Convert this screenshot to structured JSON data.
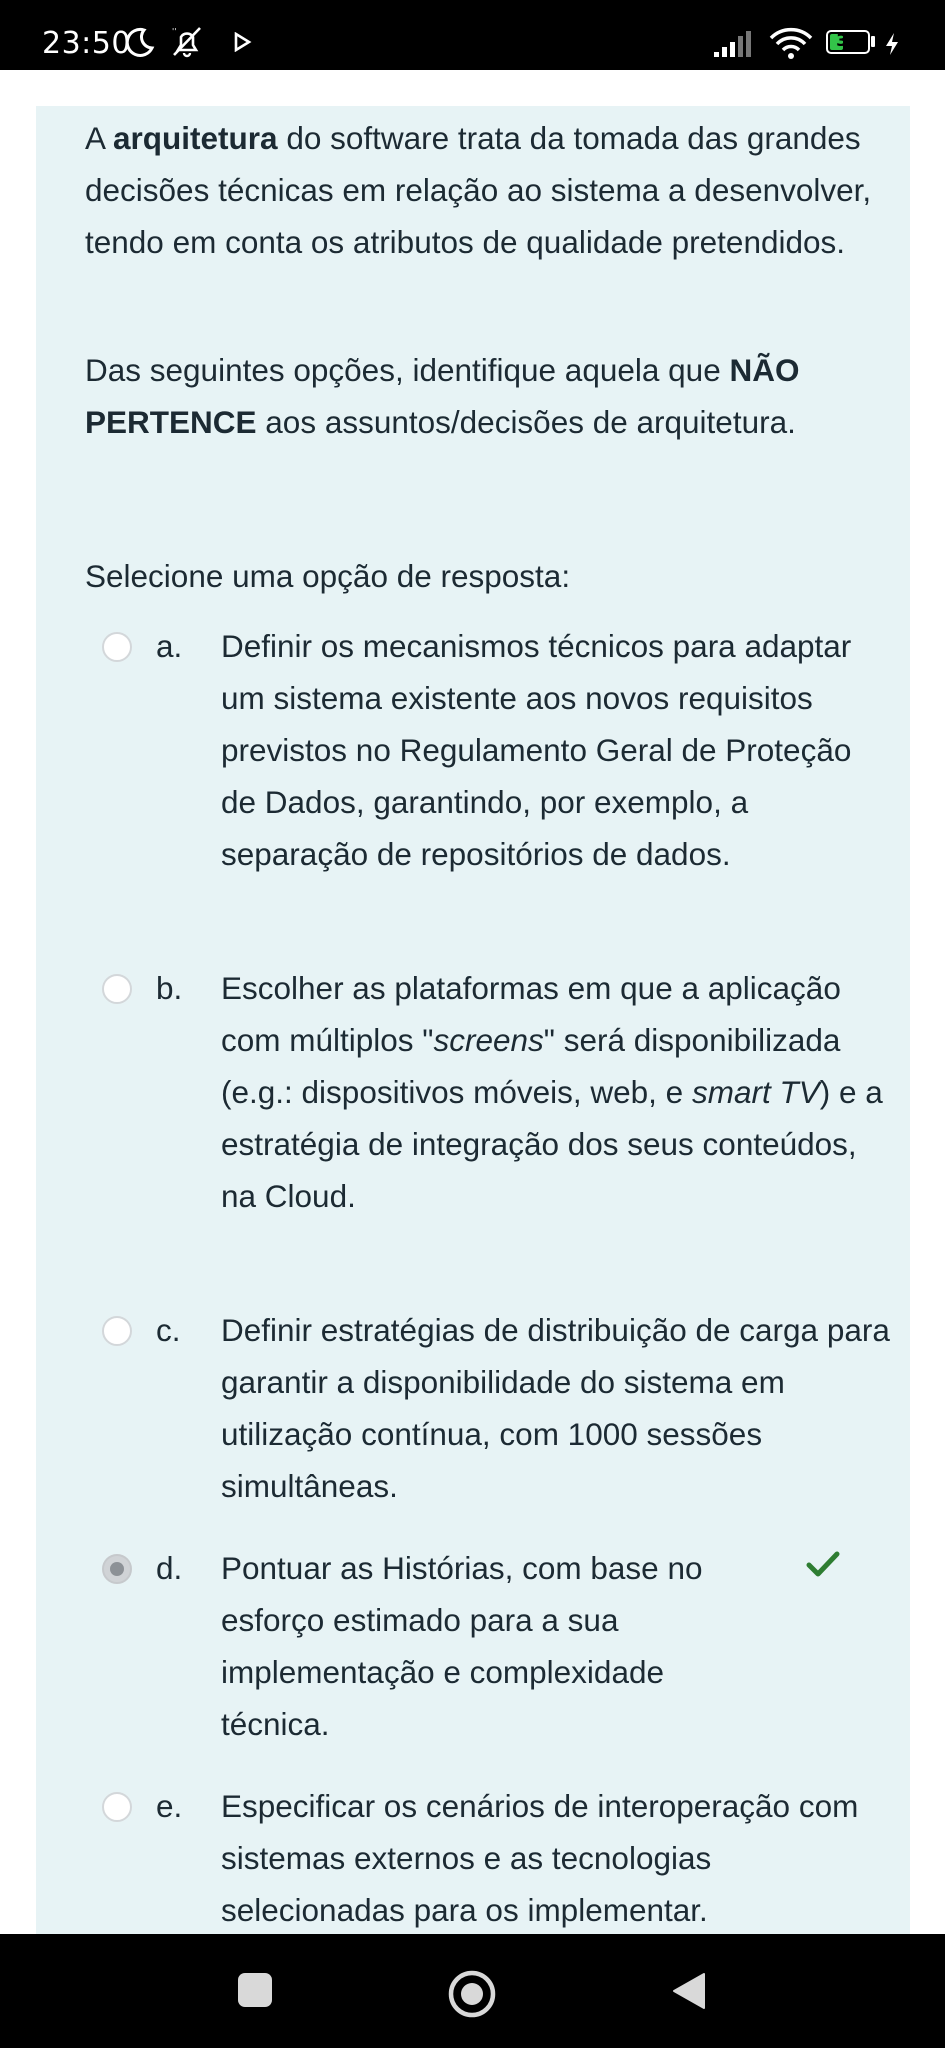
{
  "status_bar": {
    "time": "23:50",
    "battery": "35",
    "battery_level_percent": 35,
    "icons": [
      "moon-icon",
      "notifications-off-icon",
      "play-icon",
      "signal-icon",
      "wifi-icon",
      "battery-icon",
      "charging-icon"
    ]
  },
  "question": {
    "intro_pre": "A ",
    "intro_bold": "arquitetura",
    "intro_post": " do software trata da tomada das grandes decisões técnicas em relação ao sistema a desenvolver, tendo em conta os atributos de qualidade pretendidos.",
    "ask_pre": "Das seguintes opções, identifique aquela que ",
    "ask_bold": "NÃO PERTENCE",
    "ask_post": " aos assuntos/decisões de arquitetura.",
    "prompt": "Selecione uma opção de resposta:"
  },
  "options": [
    {
      "letter": "a.",
      "text": "Definir os mecanismos técnicos para adaptar um sistema existente aos novos requisitos previstos no Regulamento Geral de Proteção de Dados, garantindo, por exemplo, a separação de repositórios de dados.",
      "selected": false
    },
    {
      "letter": "b.",
      "text_parts": [
        "Escolher as plataformas em que a aplicação com múltiplos \"",
        "screens",
        "\" será disponibilizada (e.g.: dispositivos móveis, web, e ",
        "smart TV",
        ") e a estratégia de integração dos seus conteúdos, na Cloud."
      ],
      "selected": false
    },
    {
      "letter": "c.",
      "text": "Definir estratégias de distribuição de carga para garantir a disponibilidade do sistema em utilização contínua, com 1000 sessões simultâneas.",
      "selected": false
    },
    {
      "letter": "d.",
      "text": "Pontuar as Histórias, com base no esforço estimado para a sua implementação e complexidade técnica.",
      "selected": true,
      "correct": true
    },
    {
      "letter": "e.",
      "text": "Especificar os cenários de interoperação com sistemas externos e as tecnologias selecionadas para os implementar.",
      "selected": false
    }
  ],
  "colors": {
    "card_background": "#e7f3f5",
    "text": "#1c2a33",
    "correct_check": "#2e7d32"
  }
}
